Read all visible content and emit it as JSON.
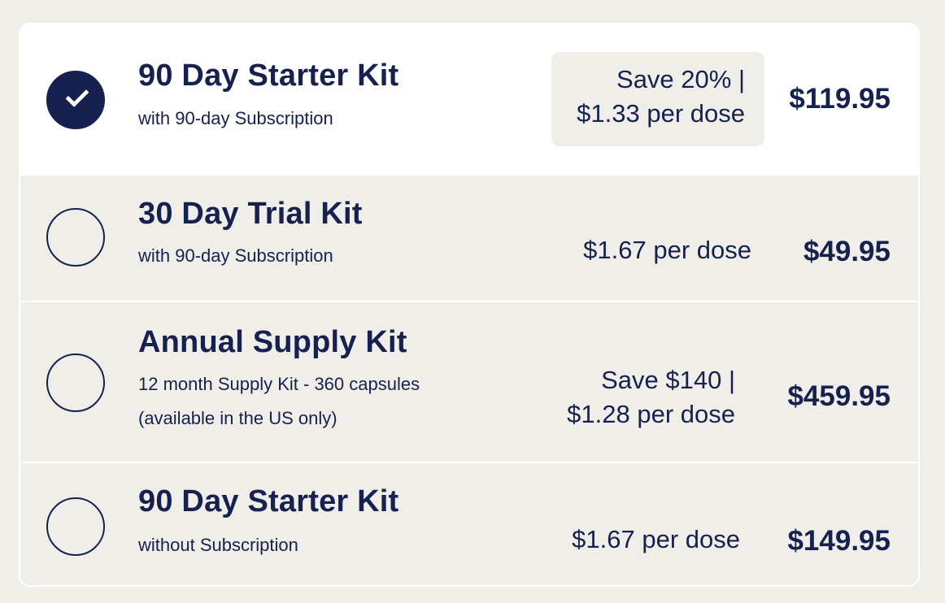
{
  "options": [
    {
      "title": "90 Day Starter Kit",
      "subtitle": "with 90-day Subscription",
      "savings_line1": "Save 20% |",
      "savings_line2": "$1.33 per dose",
      "price": "$119.95",
      "selected": true
    },
    {
      "title": "30 Day Trial Kit",
      "subtitle": "with 90-day Subscription",
      "per_dose": "$1.67 per dose",
      "price": "$49.95",
      "selected": false
    },
    {
      "title": "Annual Supply Kit",
      "subtitle": "12 month Supply Kit - 360 capsules",
      "subtitle2": "(available in the US only)",
      "savings_line1": "Save $140 |",
      "savings_line2": "$1.28 per dose",
      "price": "$459.95",
      "selected": false
    },
    {
      "title": "90 Day Starter Kit",
      "subtitle": "without Subscription",
      "per_dose": "$1.67 per dose",
      "price": "$149.95",
      "selected": false
    }
  ],
  "colors": {
    "navy": "#16214f",
    "background": "#f0eee9",
    "selected_background": "#ffffff"
  },
  "icons": {
    "selected": "checkmark-icon"
  }
}
